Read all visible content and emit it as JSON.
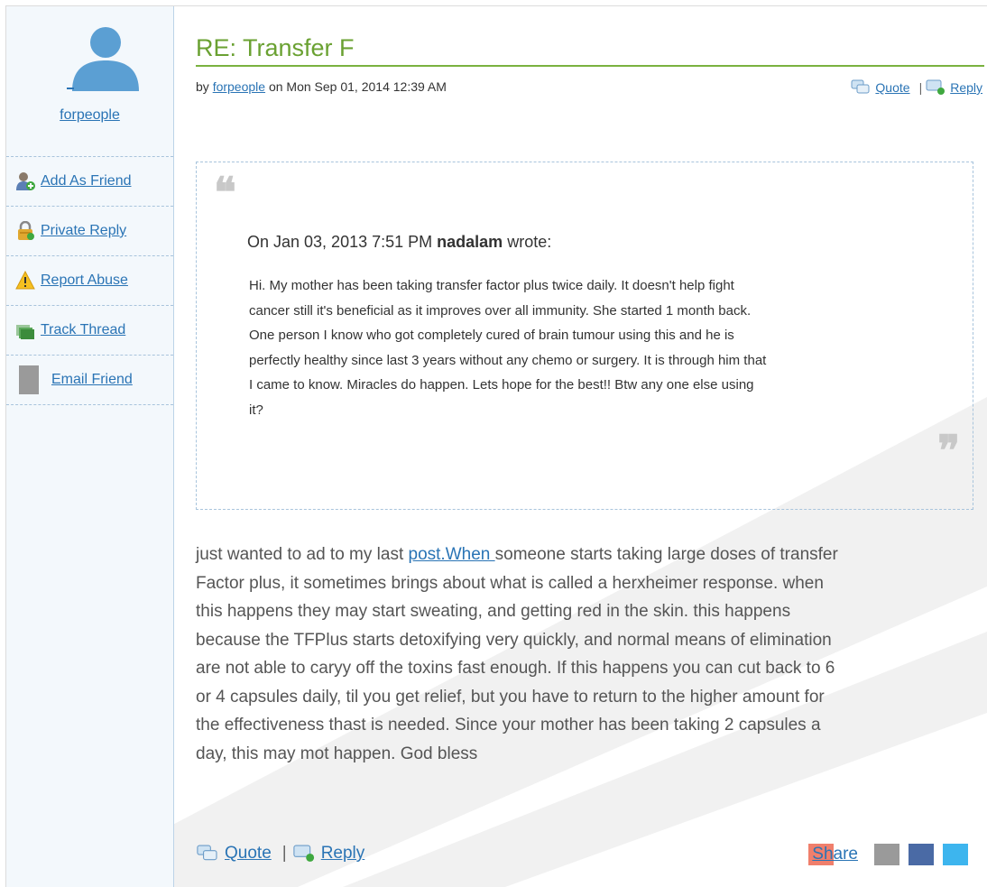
{
  "sidebar": {
    "username": "forpeople",
    "actions": [
      {
        "label": "Add As Friend",
        "icon": "add-friend-icon"
      },
      {
        "label": "Private Reply",
        "icon": "private-reply-icon"
      },
      {
        "label": "Report Abuse",
        "icon": "warning-icon"
      },
      {
        "label": "Track Thread",
        "icon": "track-thread-icon"
      },
      {
        "label": "Email Friend",
        "icon": "email-friend-icon"
      }
    ]
  },
  "post": {
    "title": "RE: Transfer F",
    "byline": {
      "prefix": "by",
      "author": "forpeople",
      "date": "on Mon Sep 01, 2014 12:39 AM"
    },
    "top_actions": {
      "quote": "Quote",
      "separator": "|",
      "reply": "Reply"
    },
    "quote": {
      "header_prefix": "On Jan 03, 2013 7:51 PM",
      "author": "nadalam",
      "header_suffix": "wrote:",
      "body": "Hi. My mother has been taking transfer factor plus twice daily. It doesn't help fight\n cancer still it's beneficial as it improves over all immunity. She started 1 month back.\n One person I know who got completely cured of brain tumour using this and he is\n perfectly healthy since last 3 years without any chemo or surgery. It is through him that\n I came to know. Miracles do happen. Lets hope for the best!! Btw any one else using\n it?"
    },
    "body_start": "just wanted to ad to my last ",
    "body_link": "post.When ",
    "body_rest": "someone starts taking large doses of transfer\n Factor plus, it sometimes brings about what is called a herxheimer response. when\n this happens they may start sweating, and getting red in the skin. this happens\n because the TFPlus starts detoxifying very quickly, and normal means of elimination\n are not able to caryy off the toxins fast enough. If this happens you can cut back to 6\n or 4 capsules daily, til you get relief, but you have to return to the higher amount for\n the effectiveness thast is needed. Since your mother has been taking 2 capsules a\n day, this may mot happen. God bless",
    "bottom_actions": {
      "quote": "Quote",
      "separator": "|",
      "reply": "Reply"
    },
    "share": {
      "label": "Share",
      "colors": {
        "share": "#f07f6c",
        "email": "#9a9a9a",
        "facebook": "#4a6aa5",
        "twitter": "#3db5ee"
      }
    }
  },
  "colors": {
    "title": "#6aa132",
    "link": "#2a74b5",
    "sidebar_bg": "#f3f8fc"
  }
}
